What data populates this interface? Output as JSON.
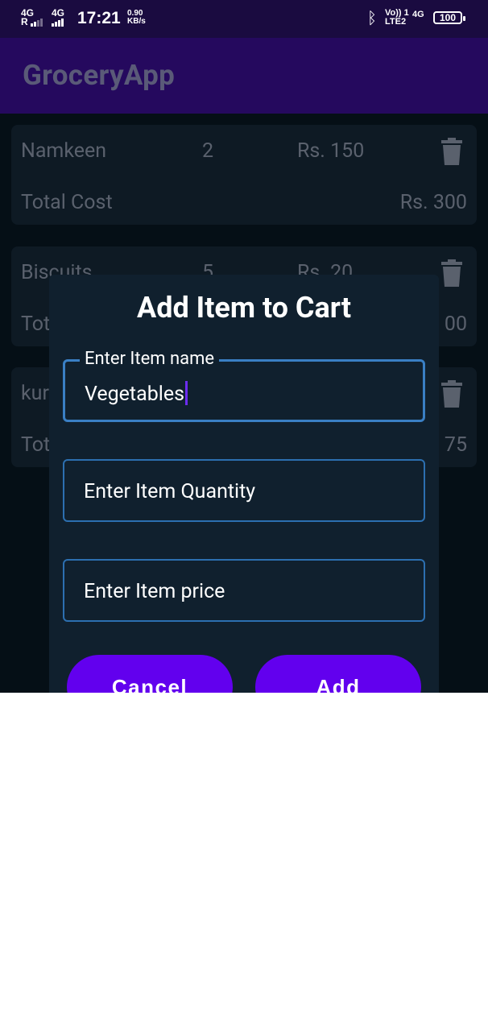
{
  "status_bar": {
    "network1": "4G",
    "network1_sub": "R",
    "network2": "4G",
    "time": "17:21",
    "speed_value": "0.90",
    "speed_unit": "KB/s",
    "volte_top": "Vo)) 1",
    "volte_bottom": "LTE2",
    "network3": "4G",
    "battery": "100"
  },
  "app_bar": {
    "title": "GroceryApp"
  },
  "cart_items": [
    {
      "name": "Namkeen",
      "quantity": "2",
      "price": "Rs. 150",
      "total_label": "Total Cost",
      "total_value": "Rs. 300"
    },
    {
      "name": "Biscuits",
      "quantity": "5",
      "price": "Rs. 20",
      "total_label": "Tot",
      "total_value": "00"
    },
    {
      "name": "kur",
      "quantity": "",
      "price": "",
      "total_label": "Tot",
      "total_value": "75"
    }
  ],
  "dialog": {
    "title": "Add Item to Cart",
    "name_field": {
      "label": "Enter Item name",
      "value": "Vegetables"
    },
    "quantity_field": {
      "placeholder": "Enter Item Quantity"
    },
    "price_field": {
      "placeholder": "Enter Item price"
    },
    "cancel_label": "Cancel",
    "add_label": "Add"
  },
  "colors": {
    "status_bar": "#1a0b40",
    "app_bar": "#25095e",
    "background": "#06121a",
    "card": "#111f2b",
    "dialog": "#10202e",
    "button": "#6200ee",
    "field_border": "#2c6fb0"
  }
}
